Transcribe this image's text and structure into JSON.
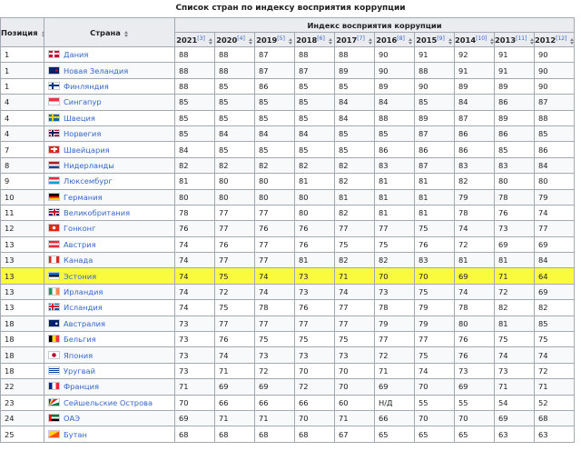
{
  "caption": "Список стран по индексу восприятия коррупции",
  "headers": {
    "position": "Позиция",
    "country": "Страна",
    "index_group": "Индекс восприятия коррупции",
    "years": [
      {
        "year": "2021",
        "ref": "[3]"
      },
      {
        "year": "2020",
        "ref": "[4]"
      },
      {
        "year": "2019",
        "ref": "[5]"
      },
      {
        "year": "2018",
        "ref": "[6]"
      },
      {
        "year": "2017",
        "ref": "[7]"
      },
      {
        "year": "2016",
        "ref": "[8]"
      },
      {
        "year": "2015",
        "ref": "[9]"
      },
      {
        "year": "2014",
        "ref": "[10]"
      },
      {
        "year": "2013",
        "ref": "[11]"
      },
      {
        "year": "2012",
        "ref": "[12]"
      }
    ]
  },
  "colors": {
    "highlight": "#fbfb3d",
    "link": "#3366cc",
    "header_bg": "#eaecf0",
    "border": "#a2a9b1"
  },
  "rows": [
    {
      "pos": "1",
      "country": "Дания",
      "flag": "denmark-flag",
      "values": [
        "88",
        "88",
        "87",
        "88",
        "88",
        "90",
        "91",
        "92",
        "91",
        "90"
      ]
    },
    {
      "pos": "1",
      "country": "Новая Зеландия",
      "flag": "new-zealand-flag",
      "values": [
        "88",
        "88",
        "87",
        "87",
        "89",
        "90",
        "88",
        "91",
        "91",
        "90"
      ]
    },
    {
      "pos": "1",
      "country": "Финляндия",
      "flag": "finland-flag",
      "values": [
        "88",
        "85",
        "86",
        "85",
        "85",
        "89",
        "90",
        "89",
        "89",
        "90"
      ]
    },
    {
      "pos": "4",
      "country": "Сингапур",
      "flag": "singapore-flag",
      "values": [
        "85",
        "85",
        "85",
        "85",
        "84",
        "84",
        "85",
        "84",
        "86",
        "87"
      ]
    },
    {
      "pos": "4",
      "country": "Швеция",
      "flag": "sweden-flag",
      "values": [
        "85",
        "85",
        "85",
        "85",
        "84",
        "88",
        "89",
        "87",
        "89",
        "88"
      ]
    },
    {
      "pos": "4",
      "country": "Норвегия",
      "flag": "norway-flag",
      "values": [
        "85",
        "84",
        "84",
        "84",
        "85",
        "85",
        "87",
        "86",
        "86",
        "85"
      ]
    },
    {
      "pos": "7",
      "country": "Швейцария",
      "flag": "switzerland-flag",
      "values": [
        "84",
        "85",
        "85",
        "85",
        "85",
        "86",
        "86",
        "86",
        "85",
        "86"
      ]
    },
    {
      "pos": "8",
      "country": "Нидерланды",
      "flag": "netherlands-flag",
      "values": [
        "82",
        "82",
        "82",
        "82",
        "82",
        "83",
        "87",
        "83",
        "83",
        "84"
      ]
    },
    {
      "pos": "9",
      "country": "Люксембург",
      "flag": "luxembourg-flag",
      "values": [
        "81",
        "80",
        "80",
        "81",
        "82",
        "81",
        "81",
        "82",
        "80",
        "80"
      ]
    },
    {
      "pos": "10",
      "country": "Германия",
      "flag": "germany-flag",
      "values": [
        "80",
        "80",
        "80",
        "80",
        "81",
        "81",
        "81",
        "79",
        "78",
        "79"
      ]
    },
    {
      "pos": "11",
      "country": "Великобритания",
      "flag": "uk-flag",
      "values": [
        "78",
        "77",
        "77",
        "80",
        "82",
        "81",
        "81",
        "78",
        "76",
        "74"
      ]
    },
    {
      "pos": "12",
      "country": "Гонконг",
      "flag": "hong-kong-flag",
      "values": [
        "76",
        "77",
        "76",
        "76",
        "77",
        "77",
        "75",
        "74",
        "73",
        "77"
      ]
    },
    {
      "pos": "13",
      "country": "Австрия",
      "flag": "austria-flag",
      "values": [
        "74",
        "76",
        "77",
        "76",
        "75",
        "75",
        "76",
        "72",
        "69",
        "69"
      ]
    },
    {
      "pos": "13",
      "country": "Канада",
      "flag": "canada-flag",
      "values": [
        "74",
        "77",
        "77",
        "81",
        "82",
        "82",
        "83",
        "81",
        "81",
        "84"
      ]
    },
    {
      "pos": "13",
      "country": "Эстония",
      "flag": "estonia-flag",
      "highlight": true,
      "values": [
        "74",
        "75",
        "74",
        "73",
        "71",
        "70",
        "70",
        "69",
        "71",
        "64"
      ]
    },
    {
      "pos": "13",
      "country": "Ирландия",
      "flag": "ireland-flag",
      "values": [
        "74",
        "72",
        "74",
        "73",
        "74",
        "73",
        "75",
        "74",
        "72",
        "69"
      ]
    },
    {
      "pos": "13",
      "country": "Исландия",
      "flag": "iceland-flag",
      "values": [
        "74",
        "75",
        "78",
        "76",
        "77",
        "78",
        "79",
        "78",
        "82",
        "82"
      ]
    },
    {
      "pos": "18",
      "country": "Австралия",
      "flag": "australia-flag",
      "values": [
        "73",
        "77",
        "77",
        "77",
        "77",
        "79",
        "79",
        "80",
        "81",
        "85"
      ]
    },
    {
      "pos": "18",
      "country": "Бельгия",
      "flag": "belgium-flag",
      "values": [
        "73",
        "76",
        "75",
        "75",
        "75",
        "77",
        "77",
        "76",
        "75",
        "75"
      ]
    },
    {
      "pos": "18",
      "country": "Япония",
      "flag": "japan-flag",
      "values": [
        "73",
        "74",
        "73",
        "73",
        "73",
        "72",
        "75",
        "76",
        "74",
        "74"
      ]
    },
    {
      "pos": "18",
      "country": "Уругвай",
      "flag": "uruguay-flag",
      "values": [
        "73",
        "71",
        "72",
        "70",
        "70",
        "71",
        "74",
        "73",
        "73",
        "72"
      ]
    },
    {
      "pos": "22",
      "country": "Франция",
      "flag": "france-flag",
      "values": [
        "71",
        "69",
        "69",
        "72",
        "70",
        "69",
        "70",
        "69",
        "71",
        "71"
      ]
    },
    {
      "pos": "23",
      "country": "Сейшельские Острова",
      "flag": "seychelles-flag",
      "values": [
        "70",
        "66",
        "66",
        "66",
        "60",
        "Н/Д",
        "55",
        "55",
        "54",
        "52"
      ]
    },
    {
      "pos": "24",
      "country": "ОАЭ",
      "flag": "uae-flag",
      "values": [
        "69",
        "71",
        "71",
        "70",
        "71",
        "66",
        "70",
        "70",
        "69",
        "68"
      ]
    },
    {
      "pos": "25",
      "country": "Бутан",
      "flag": "bhutan-flag",
      "values": [
        "68",
        "68",
        "68",
        "68",
        "67",
        "65",
        "65",
        "65",
        "63",
        "63"
      ]
    }
  ]
}
